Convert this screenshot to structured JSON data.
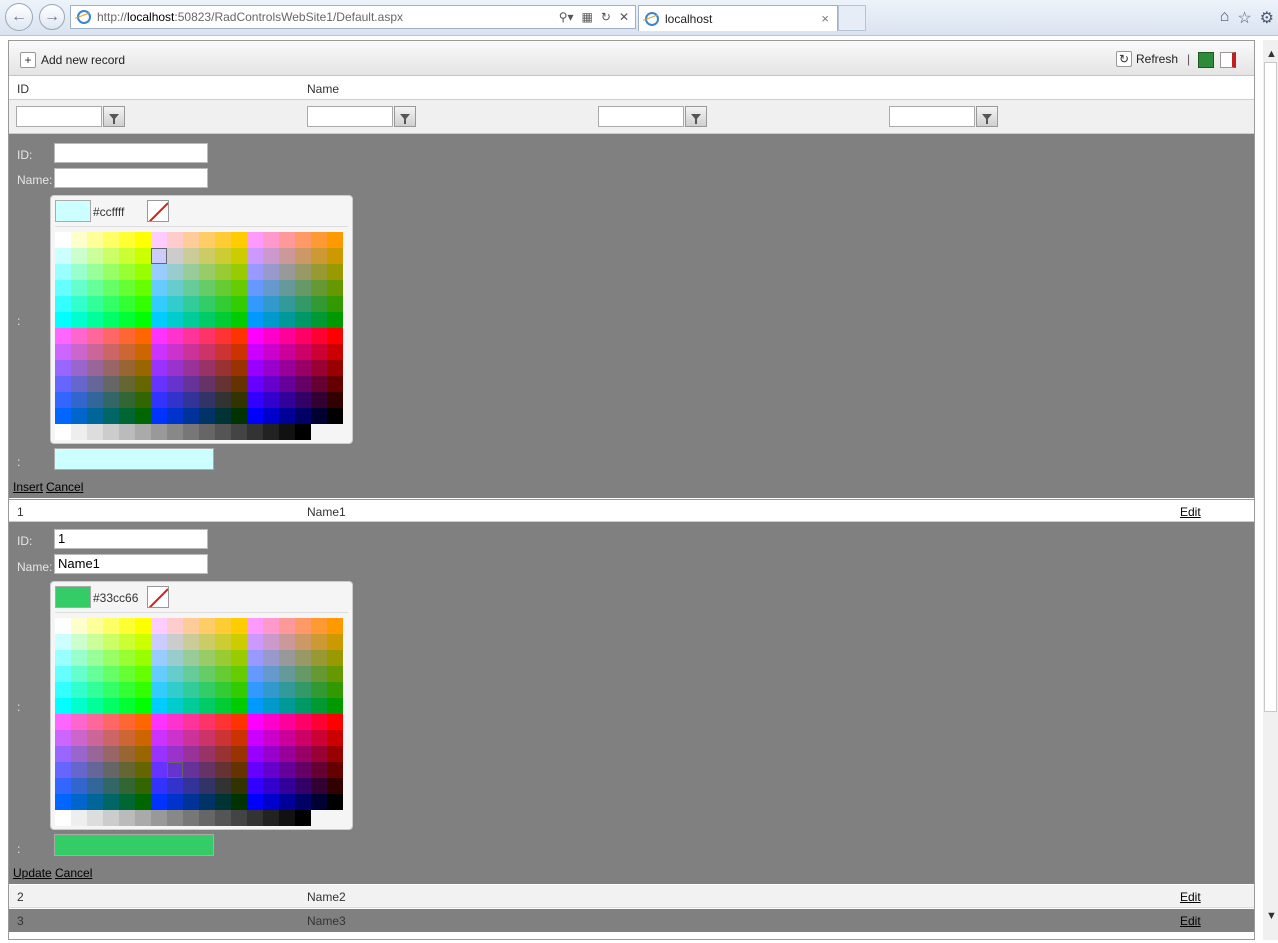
{
  "browser": {
    "url_prefix": "http://",
    "url_domain": "localhost",
    "url_rest": ":50823/RadControlsWebSite1/Default.aspx",
    "tab_title": "localhost",
    "tab_close": "×"
  },
  "toolbar": {
    "add_label": "Add new record",
    "refresh_label": "Refresh",
    "separator": "|"
  },
  "columns": [
    "ID",
    "Name"
  ],
  "insert_form": {
    "id_label": "ID:",
    "name_label": "Name:",
    "id_value": "",
    "name_value": "",
    "color_label": ":",
    "preview_label": ":",
    "hex": "#ccffff",
    "color": "#ccffff",
    "insert_label": "Insert",
    "cancel_label": "Cancel"
  },
  "rows": [
    {
      "id": "1",
      "name": "Name1",
      "edit": "Edit"
    },
    {
      "id": "2",
      "name": "Name2",
      "edit": "Edit"
    },
    {
      "id": "3",
      "name": "Name3",
      "edit": "Edit"
    }
  ],
  "edit_form": {
    "id_label": "ID:",
    "name_label": "Name:",
    "id_value": "1",
    "name_value": "Name1",
    "color_label": ":",
    "preview_label": ":",
    "hex": "#33cc66",
    "color": "#33cc66",
    "update_label": "Update",
    "cancel_label": "Cancel"
  }
}
